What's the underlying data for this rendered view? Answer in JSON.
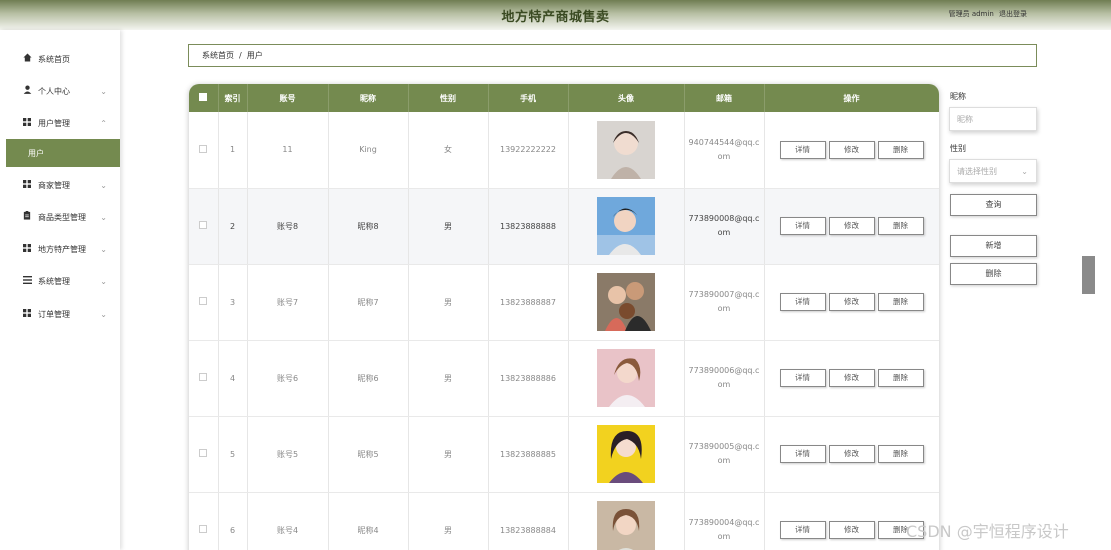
{
  "header": {
    "title": "地方特产商城售卖",
    "user_label": "管理员 admin",
    "logout_label": "退出登录"
  },
  "sidebar": {
    "items": [
      {
        "label": "系统首页",
        "icon": "home-icon",
        "expandable": false
      },
      {
        "label": "个人中心",
        "icon": "person-icon",
        "expandable": true,
        "expanded": false
      },
      {
        "label": "用户管理",
        "icon": "grid-icon",
        "expandable": true,
        "expanded": true
      },
      {
        "label": "商家管理",
        "icon": "grid-icon",
        "expandable": true,
        "expanded": false
      },
      {
        "label": "商品类型管理",
        "icon": "clipboard-icon",
        "expandable": true,
        "expanded": false
      },
      {
        "label": "地方特产管理",
        "icon": "grid-icon",
        "expandable": true,
        "expanded": false
      },
      {
        "label": "系统管理",
        "icon": "list-icon",
        "expandable": true,
        "expanded": false
      },
      {
        "label": "订单管理",
        "icon": "grid-icon",
        "expandable": true,
        "expanded": false
      }
    ],
    "active_sub": "用户",
    "active_color": "#748a4f"
  },
  "breadcrumb": {
    "home": "系统首页",
    "separator": "/",
    "current": "用户"
  },
  "table": {
    "header_color": "#748a4f",
    "columns": [
      "索引",
      "账号",
      "昵称",
      "性别",
      "手机",
      "头像",
      "邮箱",
      "操作"
    ],
    "action_labels": {
      "detail": "详情",
      "edit": "修改",
      "delete": "删除"
    },
    "rows": [
      {
        "index": "1",
        "account": "11",
        "nickname": "King",
        "gender": "女",
        "phone": "13922222222",
        "email": "940744544@qq.com"
      },
      {
        "index": "2",
        "account": "账号8",
        "nickname": "昵称8",
        "gender": "男",
        "phone": "13823888888",
        "email": "773890008@qq.com"
      },
      {
        "index": "3",
        "account": "账号7",
        "nickname": "昵称7",
        "gender": "男",
        "phone": "13823888887",
        "email": "773890007@qq.com"
      },
      {
        "index": "4",
        "account": "账号6",
        "nickname": "昵称6",
        "gender": "男",
        "phone": "13823888886",
        "email": "773890006@qq.com"
      },
      {
        "index": "5",
        "account": "账号5",
        "nickname": "昵称5",
        "gender": "男",
        "phone": "13823888885",
        "email": "773890005@qq.com"
      },
      {
        "index": "6",
        "account": "账号4",
        "nickname": "昵称4",
        "gender": "男",
        "phone": "13823888884",
        "email": "773890004@qq.com"
      }
    ]
  },
  "search_panel": {
    "nickname_label": "昵称",
    "nickname_placeholder": "昵称",
    "gender_label": "性别",
    "gender_placeholder": "请选择性别",
    "query_button": "查询",
    "add_button": "新增",
    "delete_button": "删除"
  },
  "watermark": "CSDN @宇恒程序设计"
}
